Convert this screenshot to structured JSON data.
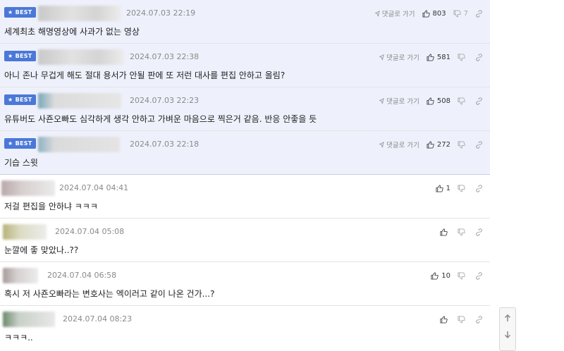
{
  "best_label": "BEST",
  "reply_label": "댓글로 가기",
  "comments": [
    {
      "best": true,
      "time": "2024.07.03 22:19",
      "text": "세계최초 해명영상에 사과가 없는 영상",
      "likes": "803",
      "dislikes": "7"
    },
    {
      "best": true,
      "time": "2024.07.03 22:38",
      "text": "아니 존나 무겁게 해도 절대 용서가 안될 판에 또 저런 대사를 편집 안하고 올림?",
      "likes": "581",
      "dislikes": ""
    },
    {
      "best": true,
      "time": "2024.07.03 22:23",
      "text": "유튜버도 사죤오빠도 심각하게 생각 안하고 가벼운 마음으로 찍은거 같음. 반응 안좋을 듯",
      "likes": "508",
      "dislikes": ""
    },
    {
      "best": true,
      "time": "2024.07.03 22:18",
      "text": "기습 스윗",
      "likes": "272",
      "dislikes": ""
    },
    {
      "best": false,
      "time": "2024.07.04 04:41",
      "text": "저걸 편집을 안하냐 ㅋㅋㅋ",
      "likes": "1",
      "dislikes": ""
    },
    {
      "best": false,
      "time": "2024.07.04 05:08",
      "text": "눈깔에 좋 맞았나..??",
      "likes": "",
      "dislikes": ""
    },
    {
      "best": false,
      "time": "2024.07.04 06:58",
      "text": "혹시 저 사죤오빠라는 변호사는 엑이러고 같이 나온 건가...?",
      "likes": "10",
      "dislikes": ""
    },
    {
      "best": false,
      "time": "2024.07.04 08:23",
      "text": "ㅋㅋㅋ..",
      "likes": "",
      "dislikes": ""
    }
  ],
  "colors": {
    "best_badge": "#4b78d8",
    "best_bg": "#eef1fb"
  }
}
